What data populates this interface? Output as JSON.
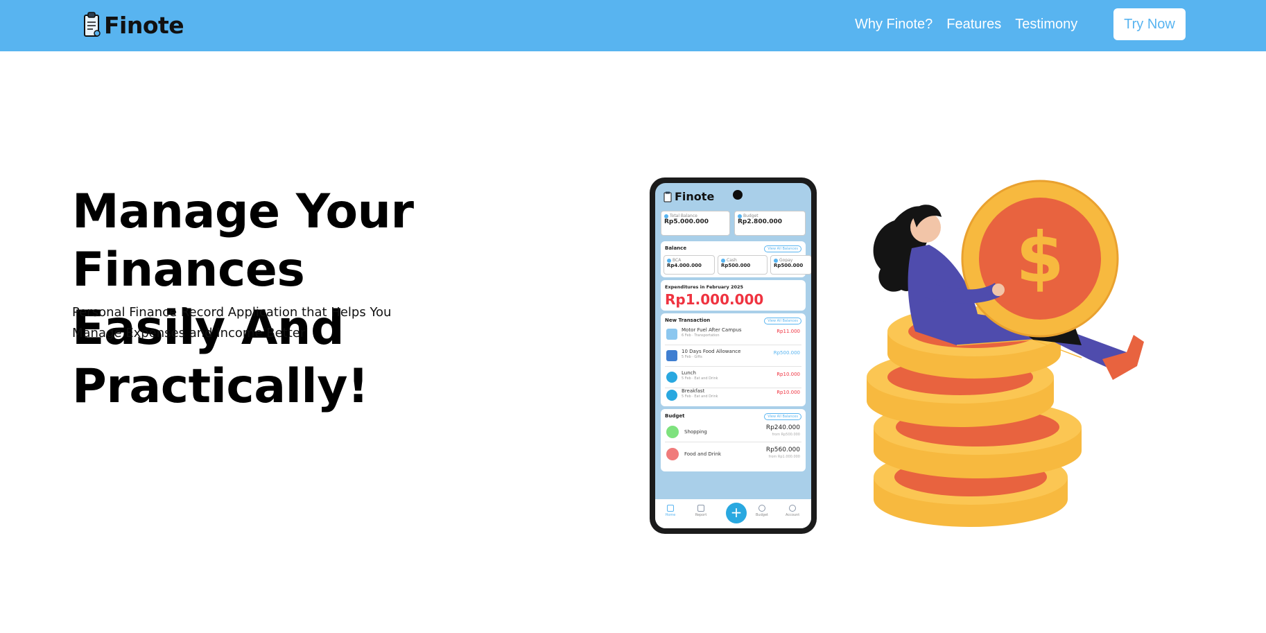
{
  "nav": {
    "brand": "Finote",
    "links": [
      "Why Finote?",
      "Features",
      "Testimony"
    ],
    "cta": "Try Now"
  },
  "hero": {
    "title_line1": "Manage Your Finances",
    "title_line2": "Easily And Practically!",
    "subtitle_line1": "Personal Finance Record Application that Helps You",
    "subtitle_line2": "Manage Expenses and Income Better"
  },
  "phone": {
    "app_name": "Finote",
    "total_balance_label": "Total Balance",
    "total_balance_value": "Rp5.000.000",
    "budget_label": "Budget",
    "budget_value": "Rp2.800.000",
    "balance_heading": "Balance",
    "view_all": "View All Balances",
    "accounts": [
      {
        "name": "BCA",
        "value": "Rp4.000.000"
      },
      {
        "name": "Cash",
        "value": "Rp500.000"
      },
      {
        "name": "Gopay",
        "value": "Rp500.000"
      }
    ],
    "expenditure_label": "Expenditures in February 2025",
    "expenditure_value": "Rp1.000.000",
    "transactions_heading": "New Transaction",
    "transactions": [
      {
        "title": "Motor Fuel After Campus",
        "sub": "6 Feb · Transportation",
        "amount": "Rp11.000",
        "type": "out"
      },
      {
        "title": "10 Days Food Allowance",
        "sub": "5 Feb · Gifts",
        "amount": "Rp500.000",
        "type": "in"
      },
      {
        "title": "Lunch",
        "sub": "5 Feb · Eat and Drink",
        "amount": "Rp10.000",
        "type": "out"
      },
      {
        "title": "Breakfast",
        "sub": "5 Feb · Eat and Drink",
        "amount": "Rp10.000",
        "type": "out"
      }
    ],
    "budget_heading": "Budget",
    "budgets": [
      {
        "title": "Shopping",
        "amount": "Rp240.000",
        "sub": "from Rp500.000",
        "color": "#7ee27e"
      },
      {
        "title": "Food and Drink",
        "amount": "Rp560.000",
        "sub": "from Rp1.000.000",
        "color": "#f07b7b"
      }
    ],
    "bottom_nav": [
      "Home",
      "Report",
      "Budget",
      "Account"
    ],
    "fab": "+"
  },
  "colors": {
    "nav_bg": "#58b4f0",
    "coin_gold": "#f7b93f",
    "coin_orange": "#e8633f",
    "figure_purple": "#4f4cad",
    "expense_red": "#ef3340"
  }
}
